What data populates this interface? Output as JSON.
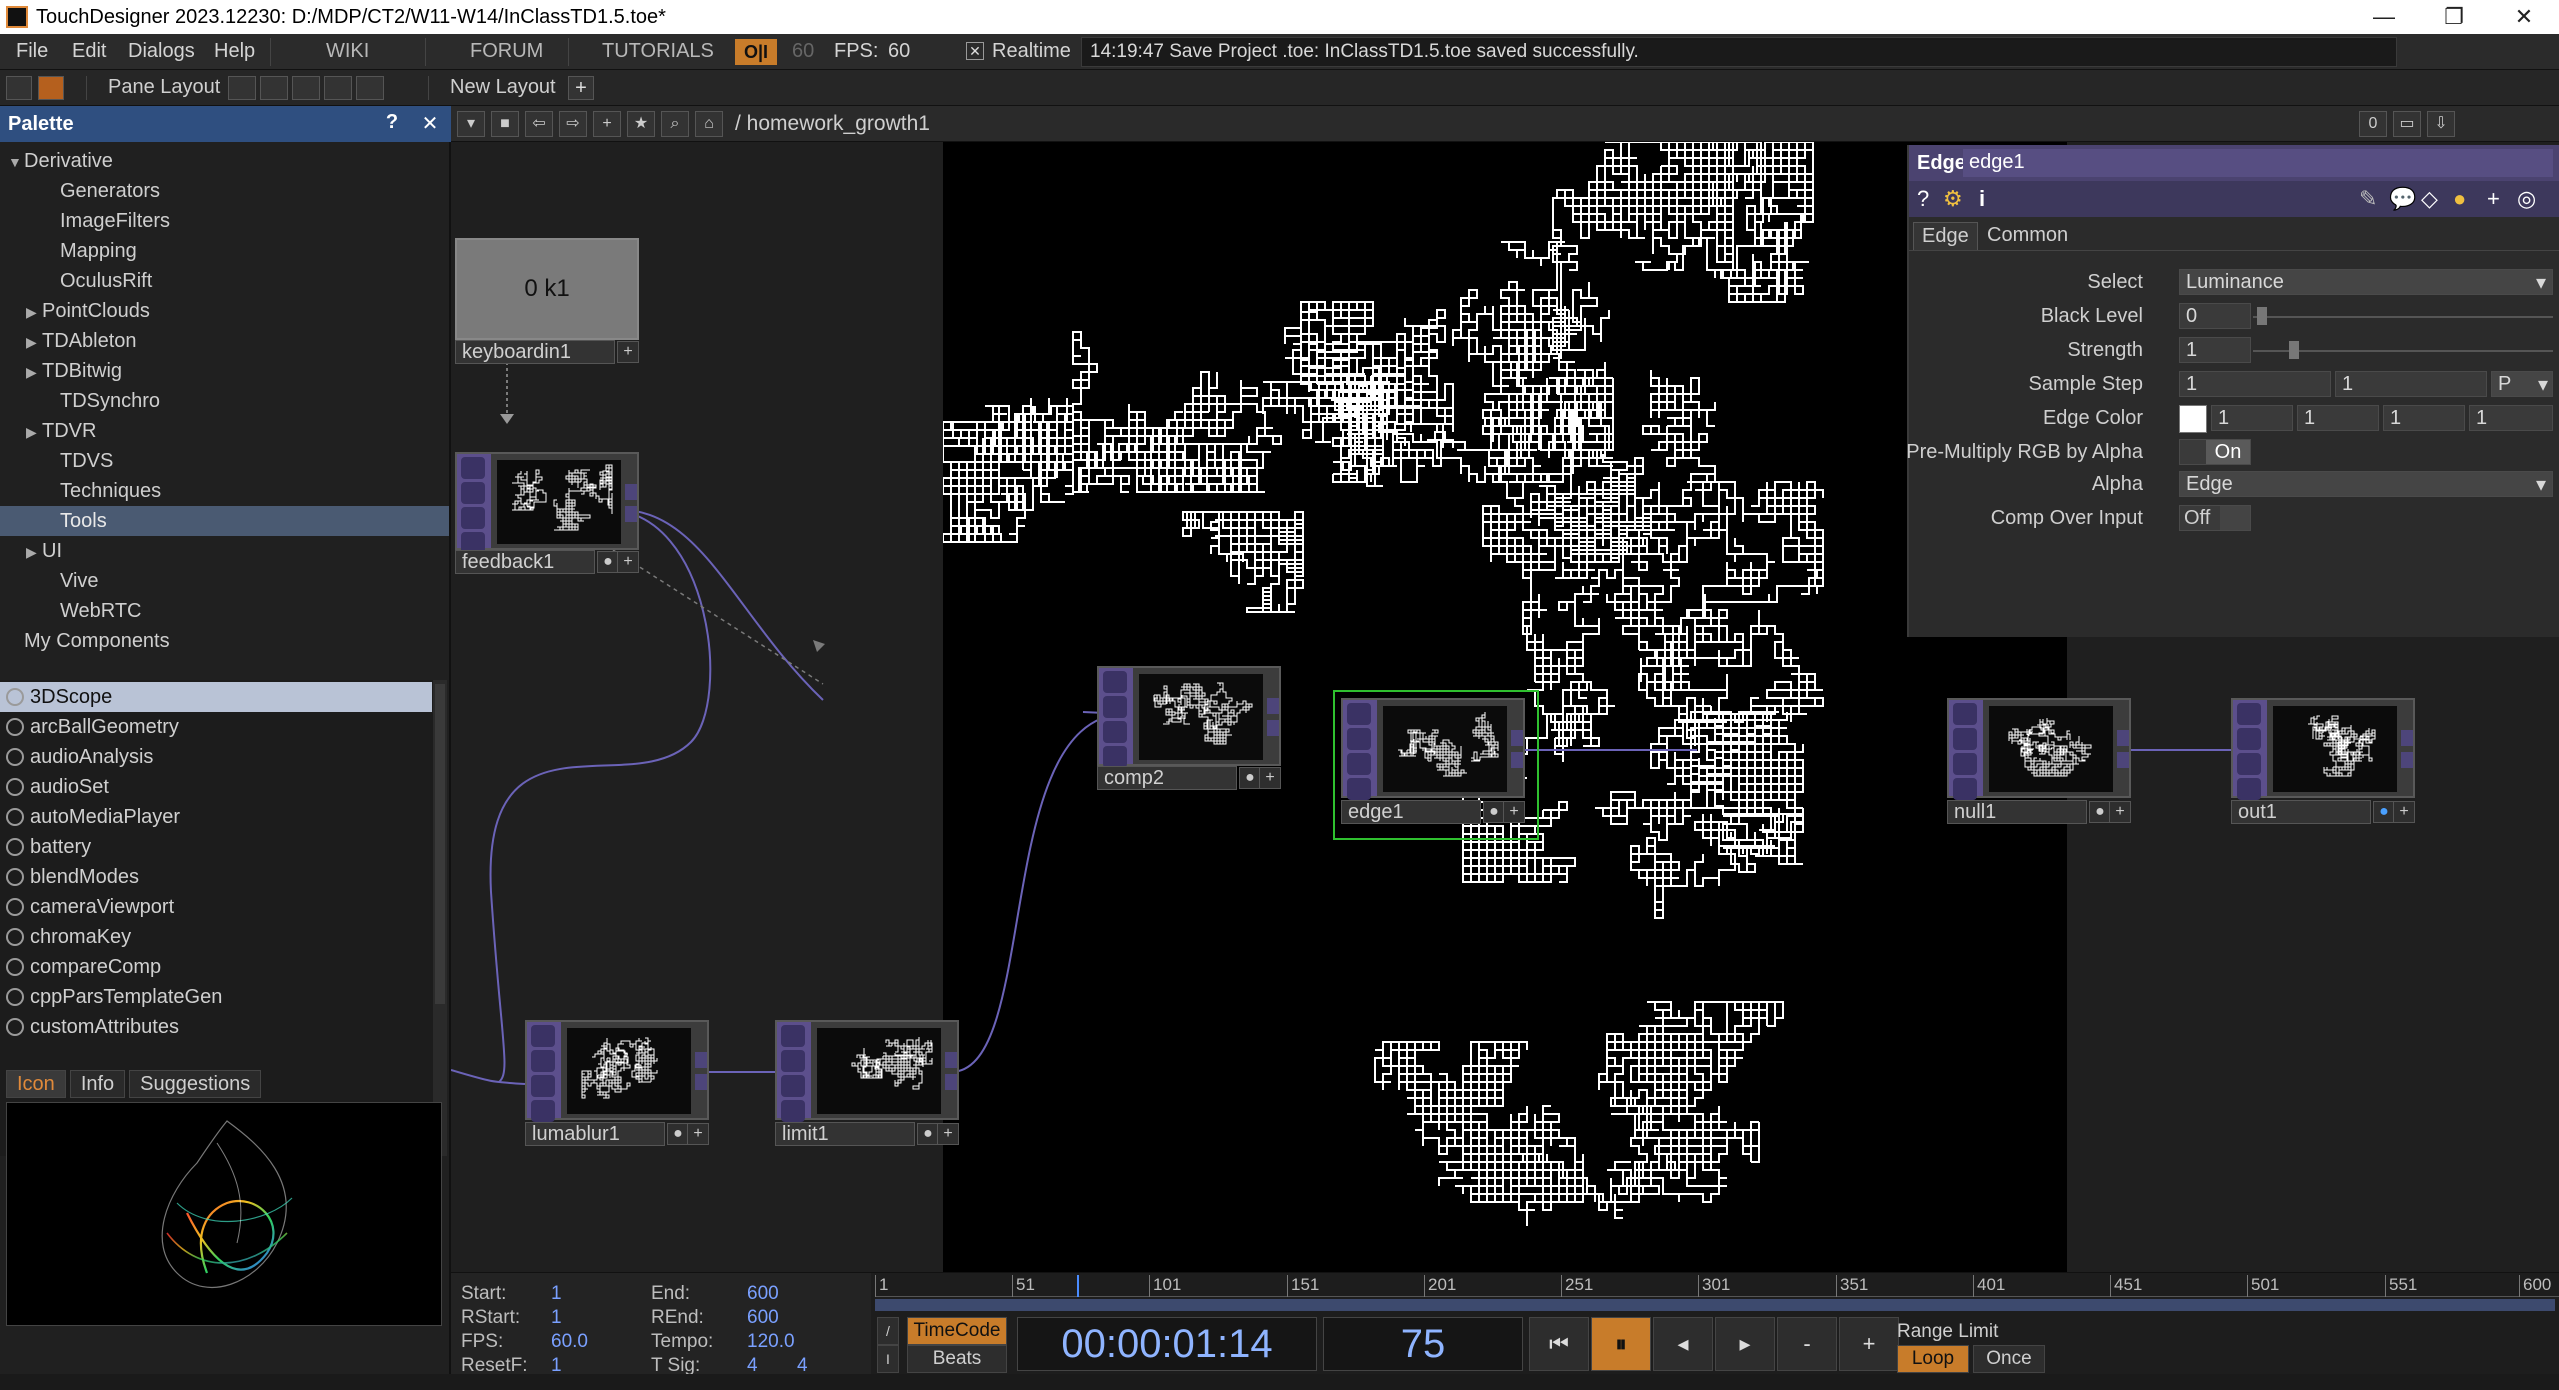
{
  "window": {
    "title": "TouchDesigner 2023.12230: D:/MDP/CT2/W11-W14/InClassTD1.5.toe*",
    "minimize": "—",
    "maximize": "❐",
    "close": "✕"
  },
  "menu": {
    "items": [
      "File",
      "Edit",
      "Dialogs",
      "Help"
    ],
    "links": [
      "WIKI",
      "FORUM",
      "TUTORIALS"
    ],
    "oi": "O|I",
    "fps_dim": "60",
    "fps_label": "FPS:",
    "fps_value": "60",
    "realtime_check": "✕",
    "realtime_label": "Realtime",
    "status": "14:19:47 Save Project .toe: InClassTD1.5.toe saved successfully."
  },
  "toolbar2": {
    "pane_layout": "Pane Layout",
    "new_layout": "New Layout",
    "add": "+"
  },
  "palette": {
    "title": "Palette",
    "help": "?",
    "close": "✕",
    "tree": [
      {
        "label": "Derivative",
        "arrow": "▼",
        "indent": 0
      },
      {
        "label": "Generators",
        "arrow": "",
        "indent": 2
      },
      {
        "label": "ImageFilters",
        "arrow": "",
        "indent": 2
      },
      {
        "label": "Mapping",
        "arrow": "",
        "indent": 2
      },
      {
        "label": "OculusRift",
        "arrow": "",
        "indent": 2
      },
      {
        "label": "PointClouds",
        "arrow": "▶",
        "indent": 1
      },
      {
        "label": "TDAbleton",
        "arrow": "▶",
        "indent": 1
      },
      {
        "label": "TDBitwig",
        "arrow": "▶",
        "indent": 1
      },
      {
        "label": "TDSynchro",
        "arrow": "",
        "indent": 2
      },
      {
        "label": "TDVR",
        "arrow": "▶",
        "indent": 1
      },
      {
        "label": "TDVS",
        "arrow": "",
        "indent": 2
      },
      {
        "label": "Techniques",
        "arrow": "",
        "indent": 2
      },
      {
        "label": "Tools",
        "arrow": "",
        "indent": 2,
        "selected": true
      },
      {
        "label": "UI",
        "arrow": "▶",
        "indent": 1
      },
      {
        "label": "Vive",
        "arrow": "",
        "indent": 2
      },
      {
        "label": "WebRTC",
        "arrow": "",
        "indent": 2
      },
      {
        "label": "My Components",
        "arrow": "",
        "indent": 0
      }
    ],
    "tools": [
      "3DScope",
      "arcBallGeometry",
      "audioAnalysis",
      "audioSet",
      "autoMediaPlayer",
      "battery",
      "blendModes",
      "cameraViewport",
      "chromaKey",
      "compareComp",
      "cppParsTemplateGen",
      "customAttributes"
    ],
    "tabs": [
      "Icon",
      "Info",
      "Suggestions"
    ]
  },
  "network": {
    "path": "/ homework_growth1",
    "level": "0",
    "nodes": {
      "keyboardin1": {
        "name": "keyboardin1",
        "value": "0 k1"
      },
      "feedback1": {
        "name": "feedback1"
      },
      "comp2": {
        "name": "comp2"
      },
      "edge1": {
        "name": "edge1"
      },
      "null1": {
        "name": "null1"
      },
      "out1": {
        "name": "out1"
      },
      "lumablur1": {
        "name": "lumablur1"
      },
      "limit1": {
        "name": "limit1"
      }
    }
  },
  "params": {
    "type": "Edge",
    "name": "edge1",
    "tabs": [
      "Edge",
      "Common"
    ],
    "select_label": "Select",
    "select_value": "Luminance",
    "black_level_label": "Black Level",
    "black_level_value": "0",
    "strength_label": "Strength",
    "strength_value": "1",
    "sample_step_label": "Sample Step",
    "sample_step_1": "1",
    "sample_step_2": "1",
    "sample_step_unit": "P",
    "edge_color_label": "Edge Color",
    "edge_color_values": [
      "1",
      "1",
      "1",
      "1"
    ],
    "premultiply_label": "Pre-Multiply RGB by Alpha",
    "premultiply_value": "On",
    "alpha_label": "Alpha",
    "alpha_value": "Edge",
    "comp_over_label": "Comp Over Input",
    "comp_over_value": "Off"
  },
  "timeline": {
    "start_label": "Start:",
    "start": "1",
    "end_label": "End:",
    "end": "600",
    "rstart_label": "RStart:",
    "rstart": "1",
    "rend_label": "REnd:",
    "rend": "600",
    "fps_label": "FPS:",
    "fps": "60.0",
    "tempo_label": "Tempo:",
    "tempo": "120.0",
    "resetf_label": "ResetF:",
    "resetf": "1",
    "tsig_label": "T Sig:",
    "tsig_a": "4",
    "tsig_b": "4",
    "ruler": [
      "1",
      "51",
      "101",
      "151",
      "201",
      "251",
      "301",
      "351",
      "401",
      "451",
      "501",
      "551",
      "600"
    ],
    "timecode_label": "TimeCode",
    "beats_label": "Beats",
    "timecode": "00:00:01:14",
    "frame": "75",
    "range_limit": "Range Limit",
    "loop": "Loop",
    "once": "Once",
    "playhead_fraction": 0.123
  }
}
